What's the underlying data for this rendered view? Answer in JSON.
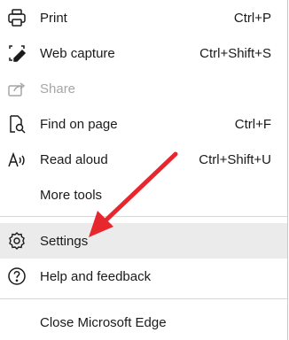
{
  "menu": {
    "print": {
      "label": "Print",
      "shortcut": "Ctrl+P",
      "icon": "printer-icon"
    },
    "web_capture": {
      "label": "Web capture",
      "shortcut": "Ctrl+Shift+S",
      "icon": "web-capture-icon"
    },
    "share": {
      "label": "Share",
      "icon": "share-icon",
      "disabled": true
    },
    "find_on_page": {
      "label": "Find on page",
      "shortcut": "Ctrl+F",
      "icon": "find-icon"
    },
    "read_aloud": {
      "label": "Read aloud",
      "shortcut": "Ctrl+Shift+U",
      "icon": "read-aloud-icon"
    },
    "more_tools": {
      "label": "More tools"
    },
    "settings": {
      "label": "Settings",
      "icon": "gear-icon",
      "highlighted": true
    },
    "help": {
      "label": "Help and feedback",
      "icon": "help-icon"
    },
    "close": {
      "label": "Close Microsoft Edge"
    }
  },
  "colors": {
    "arrow": "#e8262d",
    "highlight": "#ebebeb",
    "disabled_text": "#a6a6a6"
  }
}
